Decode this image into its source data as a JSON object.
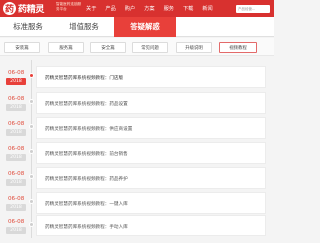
{
  "brand": {
    "logo_char": "药",
    "name": "药精灵",
    "tagline": "智能医药连锁服务平台"
  },
  "nav": {
    "items": [
      "关于",
      "产品",
      "购户",
      "方案",
      "服务",
      "下载",
      "新闻"
    ],
    "search_placeholder": "产品经营..."
  },
  "service_tabs": [
    {
      "label": "标准服务",
      "active": false
    },
    {
      "label": "增值服务",
      "active": false
    },
    {
      "label": "答疑解惑",
      "active": true
    }
  ],
  "category_chips": [
    {
      "label": "安装篇",
      "highlight": false
    },
    {
      "label": "服务篇",
      "highlight": false
    },
    {
      "label": "安全篇",
      "highlight": false
    },
    {
      "label": "常见问题",
      "highlight": false
    },
    {
      "label": "升级说明",
      "highlight": false
    },
    {
      "label": "视频教程",
      "highlight": true
    }
  ],
  "articles": [
    {
      "date": "06-08",
      "year": "2018",
      "title": "药精灵智慧药库系统视频教程：门店版",
      "active": true
    },
    {
      "date": "06-08",
      "year": "2018",
      "title": "药精灵智慧药库系统视频教程：药品设置",
      "active": false
    },
    {
      "date": "06-08",
      "year": "2018",
      "title": "药精灵智慧药库系统视频教程：供应商设置",
      "active": false
    },
    {
      "date": "06-08",
      "year": "2018",
      "title": "药精灵智慧药库系统视频教程：前台销售",
      "active": false
    },
    {
      "date": "06-08",
      "year": "2018",
      "title": "药精灵智慧药库系统视频教程：药品养护",
      "active": false
    },
    {
      "date": "06-08",
      "year": "2018",
      "title": "药精灵智慧药库系统视频教程：一键入库",
      "active": false
    },
    {
      "date": "06-08",
      "year": "2018",
      "title": "药精灵智慧药库系统视频教程：手动入库",
      "active": false
    }
  ],
  "colors": {
    "brand_red": "#d8312f",
    "accent_red": "#e8403a",
    "date_red": "#e04a3a"
  }
}
